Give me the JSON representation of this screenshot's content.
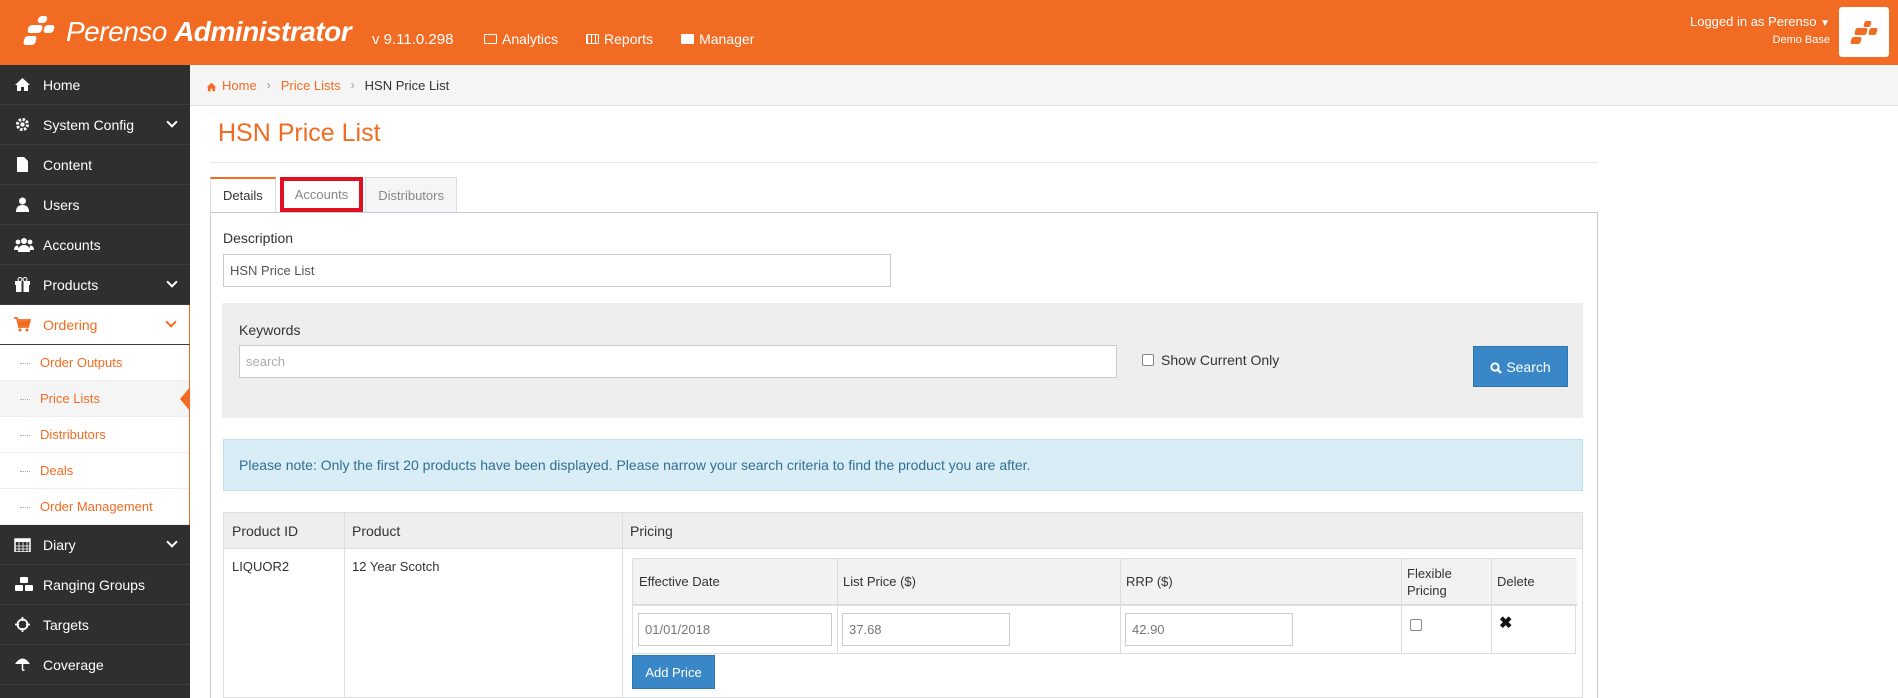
{
  "topbar": {
    "brand": "Perenso",
    "brand_bold": "Administrator",
    "version": "v 9.11.0.298",
    "nav": [
      {
        "label": "Analytics",
        "icon": "analytics-icon"
      },
      {
        "label": "Reports",
        "icon": "reports-icon"
      },
      {
        "label": "Manager",
        "icon": "briefcase-icon"
      }
    ],
    "user_label": "Logged in as Perenso",
    "user_sub": "Demo Base"
  },
  "sidebar": {
    "items": [
      {
        "label": "Home",
        "icon": "home-icon"
      },
      {
        "label": "System Config",
        "icon": "gear-icon"
      },
      {
        "label": "Content",
        "icon": "document-icon"
      },
      {
        "label": "Users",
        "icon": "user-icon"
      },
      {
        "label": "Accounts",
        "icon": "users-icon"
      },
      {
        "label": "Products",
        "icon": "gift-icon"
      },
      {
        "label": "Ordering",
        "icon": "cart-icon"
      },
      {
        "label": "Diary",
        "icon": "calendar-icon"
      },
      {
        "label": "Ranging Groups",
        "icon": "cubes-icon"
      },
      {
        "label": "Targets",
        "icon": "crosshairs-icon"
      },
      {
        "label": "Coverage",
        "icon": "umbrella-icon"
      }
    ],
    "ordering_sub": [
      {
        "label": "Order Outputs"
      },
      {
        "label": "Price Lists"
      },
      {
        "label": "Distributors"
      },
      {
        "label": "Deals"
      },
      {
        "label": "Order Management"
      }
    ]
  },
  "breadcrumb": {
    "home": "Home",
    "price_lists": "Price Lists",
    "current": "HSN Price List"
  },
  "page": {
    "title": "HSN Price List",
    "tabs": [
      "Details",
      "Accounts",
      "Distributors"
    ],
    "description_label": "Description",
    "description_value": "HSN Price List",
    "keywords_label": "Keywords",
    "keywords_placeholder": "search",
    "show_current_label": "Show Current Only",
    "search_button": "Search",
    "alert": "Please note: Only the first 20 products have been displayed. Please narrow your search criteria to find the product you are after."
  },
  "table": {
    "headers": [
      "Product ID",
      "Product",
      "Pricing"
    ],
    "rows": [
      {
        "product_id": "LIQUOR2",
        "product": "12 Year Scotch",
        "pricing_headers": [
          "Effective Date",
          "List Price ($)",
          "RRP ($)",
          "Flexible Pricing",
          "Delete"
        ],
        "prices": [
          {
            "effective_date": "01/01/2018",
            "list_price": "37.68",
            "rrp": "42.90",
            "flexible": false
          }
        ],
        "add_price_label": "Add Price"
      }
    ]
  },
  "colors": {
    "accent": "#f26b22",
    "sidebar_bg": "#2f2f2f",
    "button_blue": "#3a87c8",
    "alert_bg": "#d9edf7",
    "highlight_red": "#e01020"
  }
}
